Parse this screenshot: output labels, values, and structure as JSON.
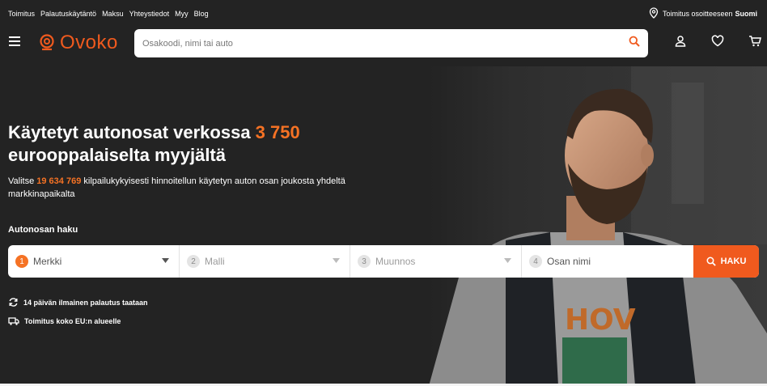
{
  "topbar": {
    "links": [
      "Toimitus",
      "Palautuskäytäntö",
      "Maksu",
      "Yhteystiedot",
      "Myy",
      "Blog"
    ],
    "delivery_text": "Toimitus osoitteeseen",
    "delivery_country": "Suomi",
    "icon": "location-pin-icon"
  },
  "header": {
    "logo_text": "Ovoko",
    "search_placeholder": "Osakoodi, nimi tai auto",
    "icons": [
      "menu-icon",
      "search-icon",
      "user-icon",
      "heart-icon",
      "cart-icon"
    ]
  },
  "hero": {
    "title_part1": "Käytetyt autonosat verkossa ",
    "title_accent": "3 750",
    "title_part2": "eurooppalaiselta myyjältä",
    "sub_part1": "Valitse ",
    "sub_count": "19 634 769",
    "sub_part2": " kilpailukykyisesti hinnoitellun käytetyn auton osan joukosta yhdeltä markkinapaikalta"
  },
  "finder": {
    "label": "Autonosan haku",
    "steps": [
      {
        "num": "1",
        "label": "Merkki"
      },
      {
        "num": "2",
        "label": "Malli"
      },
      {
        "num": "3",
        "label": "Muunnos"
      },
      {
        "num": "4",
        "label": "Osan nimi"
      }
    ],
    "button_label": "HAKU"
  },
  "features": [
    {
      "icon": "refresh-icon",
      "text": "14 päivän ilmainen palautus taataan"
    },
    {
      "icon": "truck-icon",
      "text": "Toimitus koko EU:n alueelle"
    }
  ],
  "colors": {
    "accent": "#f05a1e",
    "background": "#232323"
  }
}
